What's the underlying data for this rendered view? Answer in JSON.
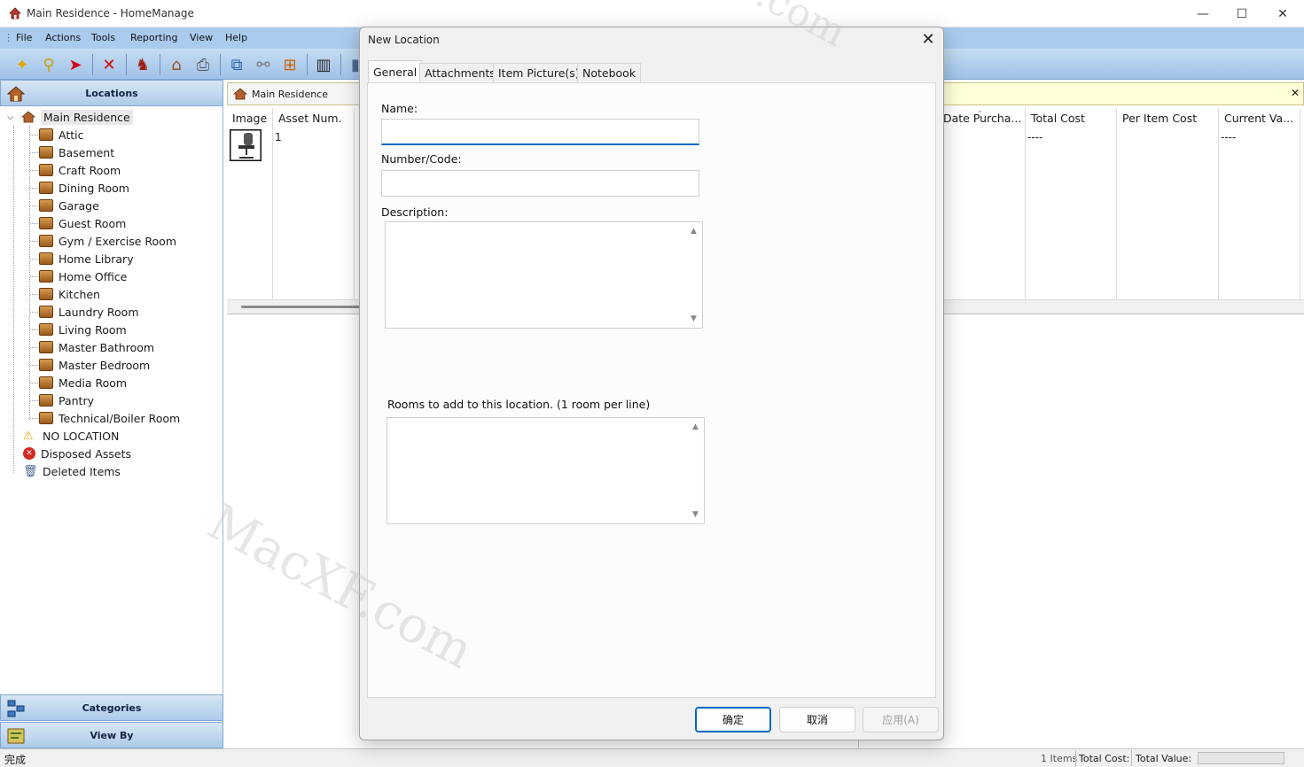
{
  "window": {
    "title": "Main Residence - HomeManage",
    "minimize": "—",
    "maximize": "☐",
    "close": "✕"
  },
  "menu": [
    "File",
    "Actions",
    "Tools",
    "Reporting",
    "View",
    "Help"
  ],
  "left_pane": {
    "locations_header": "Locations",
    "categories_header": "Categories",
    "viewby_header": "View By",
    "root": "Main Residence",
    "rooms": [
      "Attic",
      "Basement",
      "Craft Room",
      "Dining Room",
      "Garage",
      "Guest Room",
      "Gym / Exercise Room",
      "Home Library",
      "Home Office",
      "Kitchen",
      "Laundry Room",
      "Living Room",
      "Master Bathroom",
      "Master Bedroom",
      "Media Room",
      "Pantry",
      "Technical/Boiler Room"
    ],
    "special": [
      "NO LOCATION",
      "Disposed Assets",
      "Deleted Items"
    ]
  },
  "breadcrumb": {
    "label": "Main Residence",
    "close": "✕"
  },
  "grid": {
    "columns_left": [
      "Image",
      "Asset Num."
    ],
    "columns_right": [
      "Date Purcha...",
      "Total Cost",
      "Per Item Cost",
      "Current Va..."
    ],
    "row": {
      "asset_num": "1",
      "total_cost": "----",
      "current_value": "----"
    }
  },
  "status": {
    "left": "完成",
    "items": "1 Items",
    "total_cost_label": "Total Cost:",
    "total_value_label": "Total Value:"
  },
  "dialog": {
    "title": "New Location",
    "close": "✕",
    "tabs": [
      "General",
      "Attachments",
      "Item Picture(s)",
      "Notebook"
    ],
    "name_label": "Name:",
    "name_value": "",
    "number_label": "Number/Code:",
    "number_value": "",
    "description_label": "Description:",
    "rooms_label": "Rooms to add to this location.  (1 room per line)",
    "ok": "确定",
    "cancel": "取消",
    "apply": "应用(A)"
  },
  "watermarks": [
    "MacXF.com",
    ".com"
  ]
}
